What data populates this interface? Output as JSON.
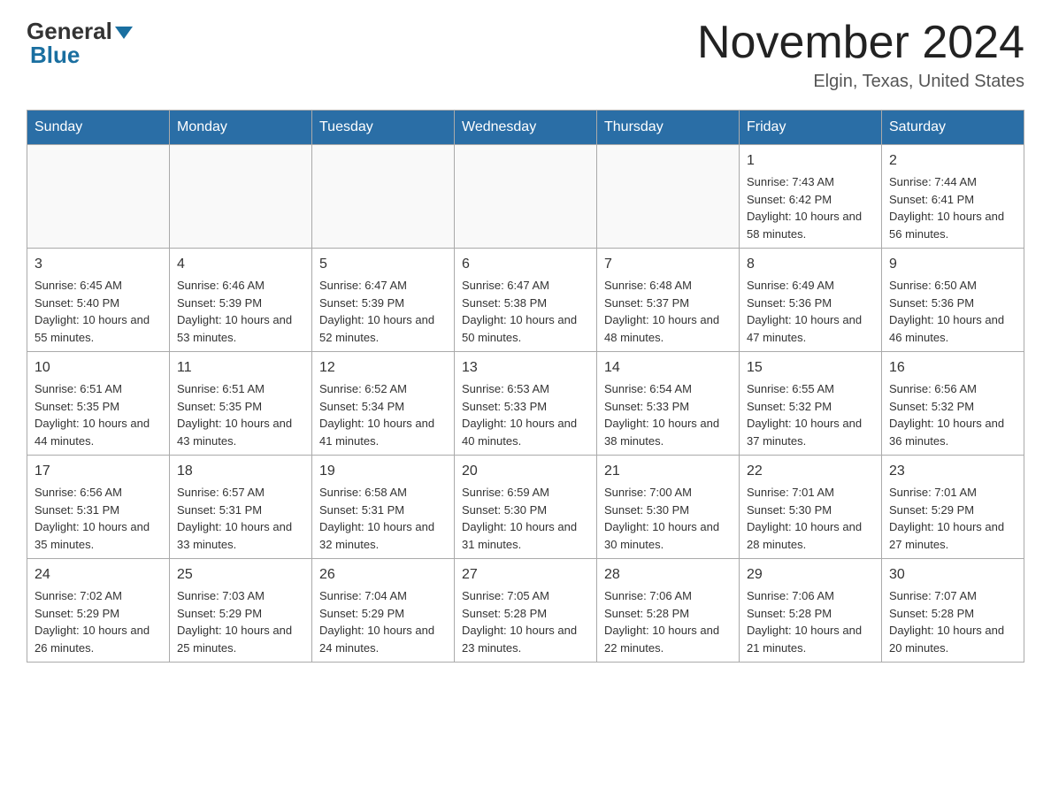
{
  "header": {
    "logo_general": "General",
    "logo_blue": "Blue",
    "month_title": "November 2024",
    "location": "Elgin, Texas, United States"
  },
  "weekdays": [
    "Sunday",
    "Monday",
    "Tuesday",
    "Wednesday",
    "Thursday",
    "Friday",
    "Saturday"
  ],
  "weeks": [
    [
      {
        "day": "",
        "info": ""
      },
      {
        "day": "",
        "info": ""
      },
      {
        "day": "",
        "info": ""
      },
      {
        "day": "",
        "info": ""
      },
      {
        "day": "",
        "info": ""
      },
      {
        "day": "1",
        "info": "Sunrise: 7:43 AM\nSunset: 6:42 PM\nDaylight: 10 hours and 58 minutes."
      },
      {
        "day": "2",
        "info": "Sunrise: 7:44 AM\nSunset: 6:41 PM\nDaylight: 10 hours and 56 minutes."
      }
    ],
    [
      {
        "day": "3",
        "info": "Sunrise: 6:45 AM\nSunset: 5:40 PM\nDaylight: 10 hours and 55 minutes."
      },
      {
        "day": "4",
        "info": "Sunrise: 6:46 AM\nSunset: 5:39 PM\nDaylight: 10 hours and 53 minutes."
      },
      {
        "day": "5",
        "info": "Sunrise: 6:47 AM\nSunset: 5:39 PM\nDaylight: 10 hours and 52 minutes."
      },
      {
        "day": "6",
        "info": "Sunrise: 6:47 AM\nSunset: 5:38 PM\nDaylight: 10 hours and 50 minutes."
      },
      {
        "day": "7",
        "info": "Sunrise: 6:48 AM\nSunset: 5:37 PM\nDaylight: 10 hours and 48 minutes."
      },
      {
        "day": "8",
        "info": "Sunrise: 6:49 AM\nSunset: 5:36 PM\nDaylight: 10 hours and 47 minutes."
      },
      {
        "day": "9",
        "info": "Sunrise: 6:50 AM\nSunset: 5:36 PM\nDaylight: 10 hours and 46 minutes."
      }
    ],
    [
      {
        "day": "10",
        "info": "Sunrise: 6:51 AM\nSunset: 5:35 PM\nDaylight: 10 hours and 44 minutes."
      },
      {
        "day": "11",
        "info": "Sunrise: 6:51 AM\nSunset: 5:35 PM\nDaylight: 10 hours and 43 minutes."
      },
      {
        "day": "12",
        "info": "Sunrise: 6:52 AM\nSunset: 5:34 PM\nDaylight: 10 hours and 41 minutes."
      },
      {
        "day": "13",
        "info": "Sunrise: 6:53 AM\nSunset: 5:33 PM\nDaylight: 10 hours and 40 minutes."
      },
      {
        "day": "14",
        "info": "Sunrise: 6:54 AM\nSunset: 5:33 PM\nDaylight: 10 hours and 38 minutes."
      },
      {
        "day": "15",
        "info": "Sunrise: 6:55 AM\nSunset: 5:32 PM\nDaylight: 10 hours and 37 minutes."
      },
      {
        "day": "16",
        "info": "Sunrise: 6:56 AM\nSunset: 5:32 PM\nDaylight: 10 hours and 36 minutes."
      }
    ],
    [
      {
        "day": "17",
        "info": "Sunrise: 6:56 AM\nSunset: 5:31 PM\nDaylight: 10 hours and 35 minutes."
      },
      {
        "day": "18",
        "info": "Sunrise: 6:57 AM\nSunset: 5:31 PM\nDaylight: 10 hours and 33 minutes."
      },
      {
        "day": "19",
        "info": "Sunrise: 6:58 AM\nSunset: 5:31 PM\nDaylight: 10 hours and 32 minutes."
      },
      {
        "day": "20",
        "info": "Sunrise: 6:59 AM\nSunset: 5:30 PM\nDaylight: 10 hours and 31 minutes."
      },
      {
        "day": "21",
        "info": "Sunrise: 7:00 AM\nSunset: 5:30 PM\nDaylight: 10 hours and 30 minutes."
      },
      {
        "day": "22",
        "info": "Sunrise: 7:01 AM\nSunset: 5:30 PM\nDaylight: 10 hours and 28 minutes."
      },
      {
        "day": "23",
        "info": "Sunrise: 7:01 AM\nSunset: 5:29 PM\nDaylight: 10 hours and 27 minutes."
      }
    ],
    [
      {
        "day": "24",
        "info": "Sunrise: 7:02 AM\nSunset: 5:29 PM\nDaylight: 10 hours and 26 minutes."
      },
      {
        "day": "25",
        "info": "Sunrise: 7:03 AM\nSunset: 5:29 PM\nDaylight: 10 hours and 25 minutes."
      },
      {
        "day": "26",
        "info": "Sunrise: 7:04 AM\nSunset: 5:29 PM\nDaylight: 10 hours and 24 minutes."
      },
      {
        "day": "27",
        "info": "Sunrise: 7:05 AM\nSunset: 5:28 PM\nDaylight: 10 hours and 23 minutes."
      },
      {
        "day": "28",
        "info": "Sunrise: 7:06 AM\nSunset: 5:28 PM\nDaylight: 10 hours and 22 minutes."
      },
      {
        "day": "29",
        "info": "Sunrise: 7:06 AM\nSunset: 5:28 PM\nDaylight: 10 hours and 21 minutes."
      },
      {
        "day": "30",
        "info": "Sunrise: 7:07 AM\nSunset: 5:28 PM\nDaylight: 10 hours and 20 minutes."
      }
    ]
  ]
}
